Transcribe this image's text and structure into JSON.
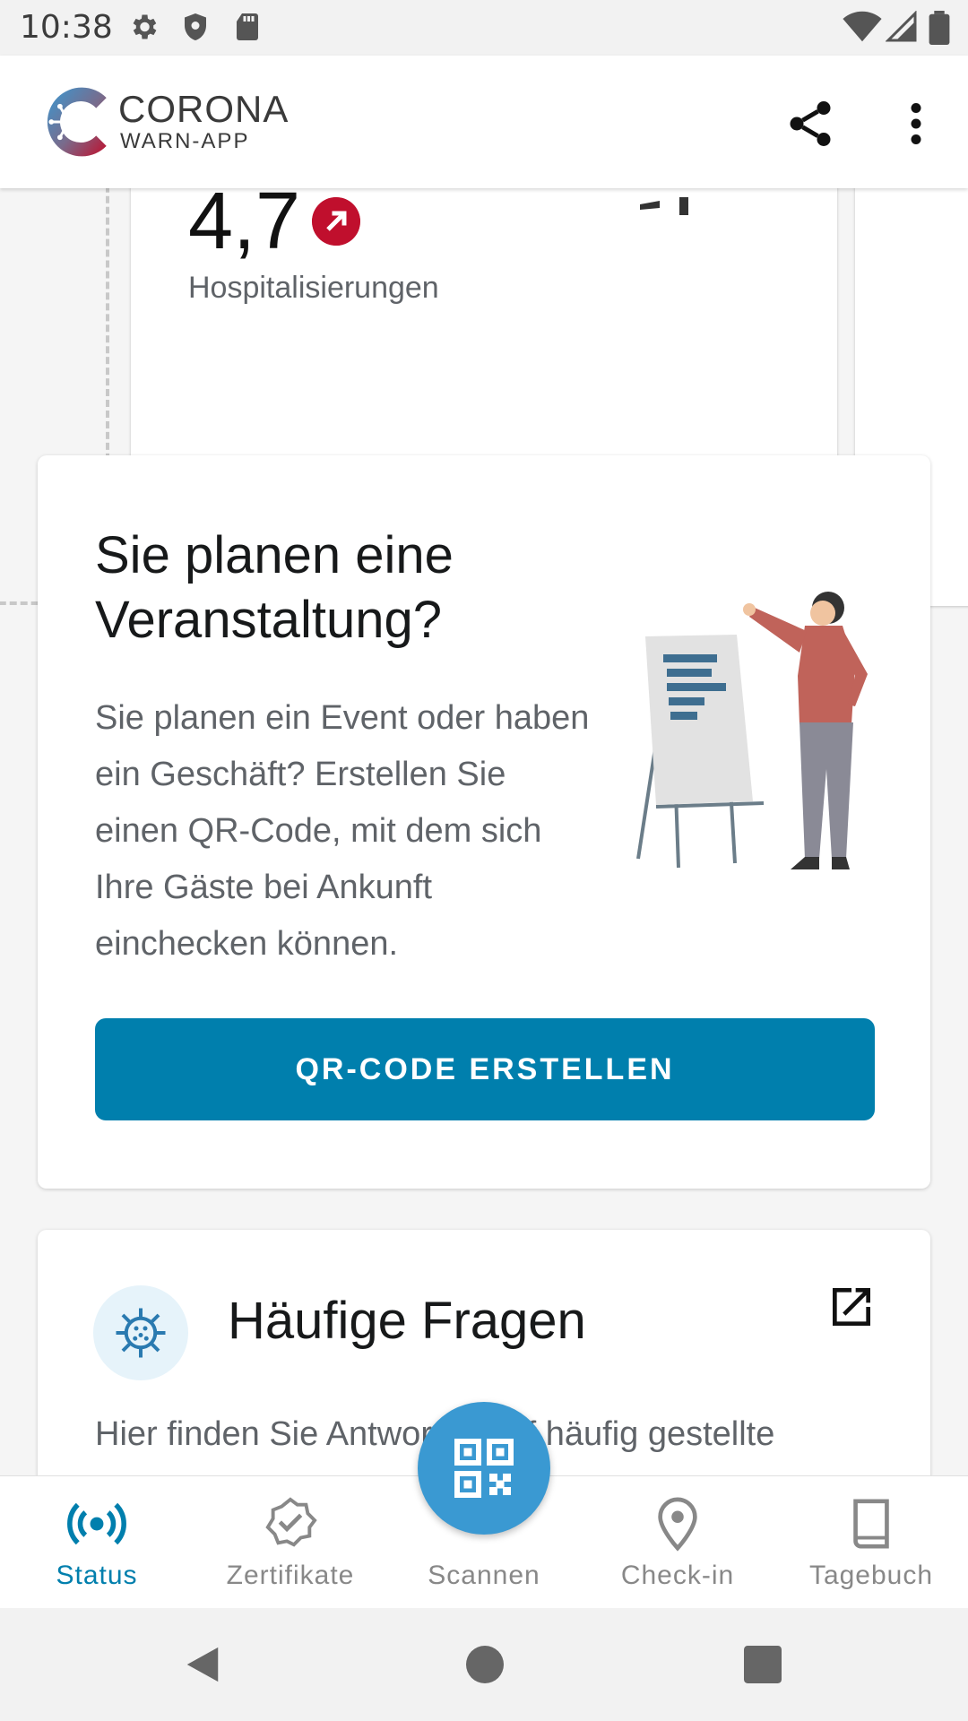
{
  "status_bar": {
    "time": "10:38",
    "icons_left": [
      "settings-icon",
      "shield-icon",
      "sdcard-icon"
    ],
    "icons_right": [
      "wifi-icon",
      "signal-icon",
      "battery-icon"
    ]
  },
  "app_bar": {
    "brand_line1": "CORONA",
    "brand_line2": "WARN-APP",
    "actions": [
      "share-icon",
      "more-vert-icon"
    ]
  },
  "stat_card": {
    "value": "4,7",
    "label": "Hospitalisierungen",
    "trend": "up",
    "trend_color": "#c00f2d"
  },
  "event_card": {
    "title": "Sie planen eine Veranstaltung?",
    "body": "Sie planen ein Event oder haben ein Geschäft? Erstellen Sie einen QR-Code, mit dem sich Ihre Gäste bei Ankunft einchecken können.",
    "button": "QR-CODE ERSTELLEN"
  },
  "faq_card": {
    "title": "Häufige Fragen",
    "body": "Hier finden Sie Antworten auf häufig gestellte"
  },
  "bottom_nav": {
    "items": [
      {
        "label": "Status",
        "icon": "radar-icon",
        "active": true
      },
      {
        "label": "Zertifikate",
        "icon": "certificate-icon",
        "active": false
      },
      {
        "label": "Scannen",
        "icon": "qr-scan-icon",
        "active": false
      },
      {
        "label": "Check-in",
        "icon": "location-pin-icon",
        "active": false
      },
      {
        "label": "Tagebuch",
        "icon": "book-icon",
        "active": false
      }
    ]
  },
  "colors": {
    "accent": "#007fad",
    "fab": "#3a99d2",
    "trend_red": "#c00f2d"
  }
}
